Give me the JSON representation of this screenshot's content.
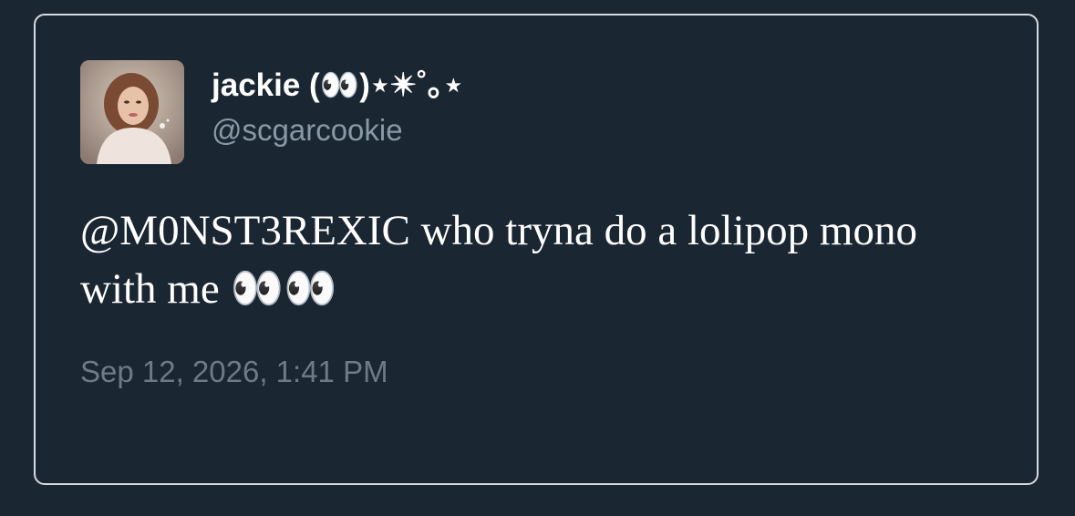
{
  "tweet": {
    "display_name": "jackie (👀)⋆✴︎˚｡⋆",
    "handle": "@scgarcookie",
    "text": "@M0NST3REXIC who tryna do a lolipop mono with me 👀👀",
    "timestamp": "Sep 12, 2026, 1:41 PM",
    "avatar_icon": "profile-photo"
  },
  "colors": {
    "background": "#1b2633",
    "border": "#d6dbe0",
    "name": "#ffffff",
    "handle": "#8899a6",
    "text": "#ffffff",
    "timestamp": "#6e7b86"
  }
}
